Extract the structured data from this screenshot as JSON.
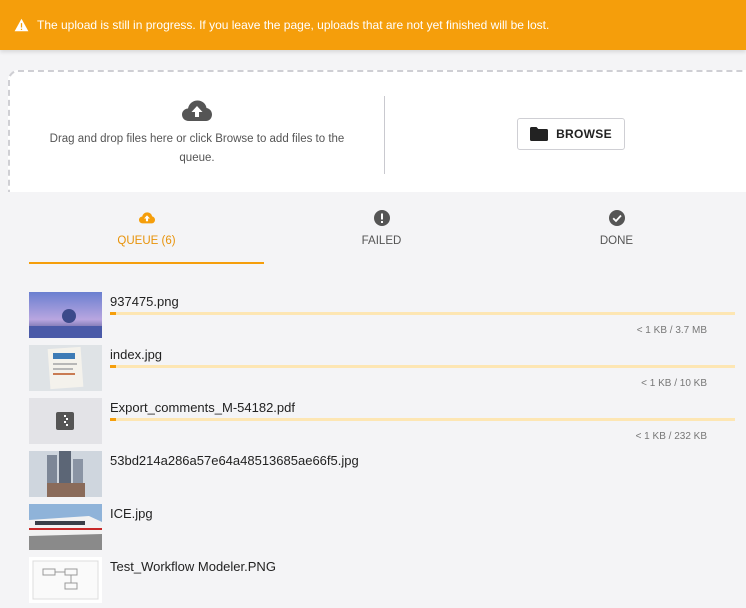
{
  "banner": {
    "message": "The upload is still in progress. If you leave the page, uploads that are not yet finished will be lost.",
    "color": "#f59e0b",
    "icon": "warning-icon"
  },
  "dropzone": {
    "hint": "Drag and drop files here or click Browse to add files to the queue.",
    "icon": "cloud-upload-icon",
    "browse_label": "BROWSE"
  },
  "tabs": [
    {
      "label": "QUEUE (6)",
      "icon": "cloud-upload-icon",
      "active": true
    },
    {
      "label": "FAILED",
      "icon": "error-icon",
      "active": false
    },
    {
      "label": "DONE",
      "icon": "check-circle-icon",
      "active": false
    }
  ],
  "files": [
    {
      "name": "937475.png",
      "size": "< 1 KB / 3.7 MB",
      "progress": 0.01
    },
    {
      "name": "index.jpg",
      "size": "< 1 KB / 10 KB",
      "progress": 0.01
    },
    {
      "name": "Export_comments_M-54182.pdf",
      "size": "< 1 KB / 232 KB",
      "progress": 0.01
    },
    {
      "name": "53bd214a286a57e64a48513685ae66f5.jpg",
      "size": "",
      "progress": null
    },
    {
      "name": "ICE.jpg",
      "size": "",
      "progress": null
    },
    {
      "name": "Test_Workflow Modeler.PNG",
      "size": "",
      "progress": null
    }
  ],
  "colors": {
    "accent": "#f59e0b",
    "progress_track": "#fde6b3"
  }
}
